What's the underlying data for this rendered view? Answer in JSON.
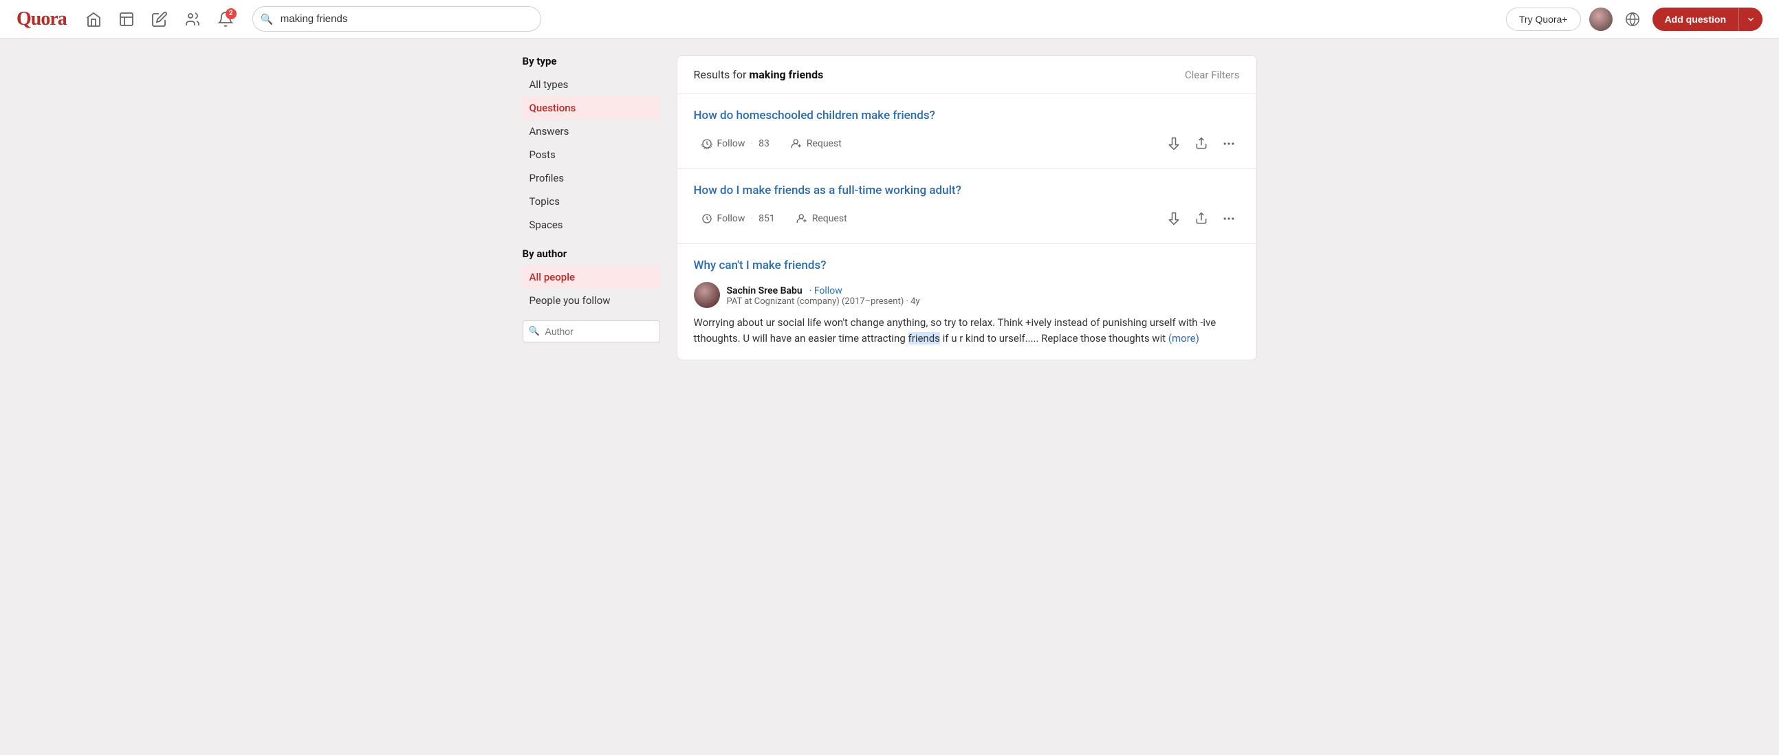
{
  "header": {
    "logo": "Quora",
    "search_placeholder": "making friends",
    "search_value": "making friends",
    "try_quora_label": "Try Quora+",
    "add_question_label": "Add question",
    "notification_count": "2"
  },
  "sidebar": {
    "by_type_title": "By type",
    "type_items": [
      {
        "id": "all-types",
        "label": "All types",
        "active": false
      },
      {
        "id": "questions",
        "label": "Questions",
        "active": true
      },
      {
        "id": "answers",
        "label": "Answers",
        "active": false
      },
      {
        "id": "posts",
        "label": "Posts",
        "active": false
      },
      {
        "id": "profiles",
        "label": "Profiles",
        "active": false
      },
      {
        "id": "topics",
        "label": "Topics",
        "active": false
      },
      {
        "id": "spaces",
        "label": "Spaces",
        "active": false
      }
    ],
    "by_author_title": "By author",
    "author_items": [
      {
        "id": "all-people",
        "label": "All people",
        "active": true
      },
      {
        "id": "people-you-follow",
        "label": "People you follow",
        "active": false
      }
    ],
    "author_search_placeholder": "Author"
  },
  "results": {
    "prefix": "Results for ",
    "query": "making friends",
    "clear_filters_label": "Clear Filters",
    "items": [
      {
        "id": "q1",
        "type": "question",
        "title": "How do homeschooled children make friends?",
        "follow_label": "Follow",
        "follow_count": "83",
        "request_label": "Request"
      },
      {
        "id": "q2",
        "type": "question",
        "title": "How do I make friends as a full-time working adult?",
        "follow_label": "Follow",
        "follow_count": "851",
        "request_label": "Request"
      },
      {
        "id": "q3",
        "type": "answer",
        "question_title": "Why can't I make friends?",
        "author_name": "Sachin Sree Babu",
        "author_follow_label": "Follow",
        "author_meta": "PAT at Cognizant (company) (2017–present) · 4y",
        "snippet": "Worrying about ur social life won't change anything, so try to relax. Think +ively instead of punishing urself with -ive tthoughts. U will have an easier time attracting friends if u r kind to urself..... Replace those thoughts wit",
        "more_label": "(more)"
      }
    ]
  }
}
